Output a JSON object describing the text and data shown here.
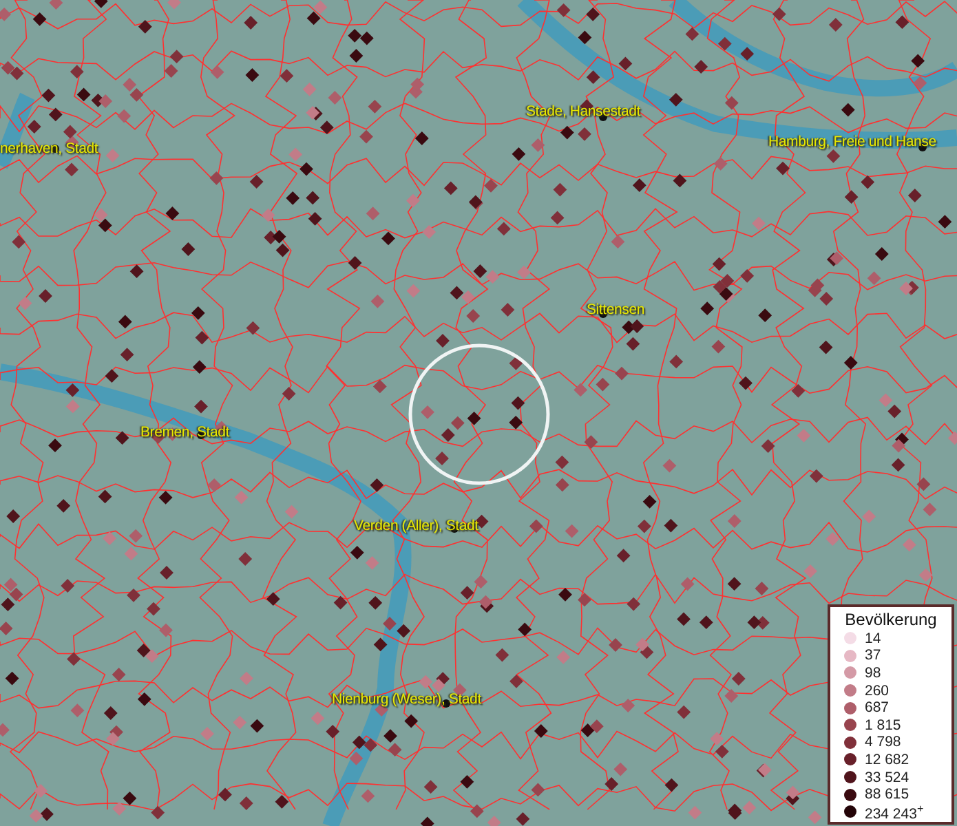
{
  "map": {
    "labels": [
      {
        "text": "nerhaven, Stadt"
      },
      {
        "text": "Stade, Hansestadt"
      },
      {
        "text": "Hamburg, Freie und Hanse"
      },
      {
        "text": "Sittensen"
      },
      {
        "text": "Bremen, Stadt"
      },
      {
        "text": "Verden (Aller), Stadt"
      },
      {
        "text": "Nienburg (Weser), Stadt"
      }
    ]
  },
  "legend": {
    "title": "Bevölkerung",
    "items": [
      {
        "label": "14",
        "color": "#f4dce6"
      },
      {
        "label": "37",
        "color": "#e6b8c4"
      },
      {
        "label": "98",
        "color": "#d49aa6"
      },
      {
        "label": "260",
        "color": "#c27c88"
      },
      {
        "label": "687",
        "color": "#ae5e6a"
      },
      {
        "label": "1 815",
        "color": "#98444e"
      },
      {
        "label": "4 798",
        "color": "#80303a"
      },
      {
        "label": "12 682",
        "color": "#68202a"
      },
      {
        "label": "33 524",
        "color": "#50141c"
      },
      {
        "label": "88 615",
        "color": "#3a0a10"
      },
      {
        "label": "234 243$^{+}$",
        "color": "#240408"
      }
    ]
  }
}
